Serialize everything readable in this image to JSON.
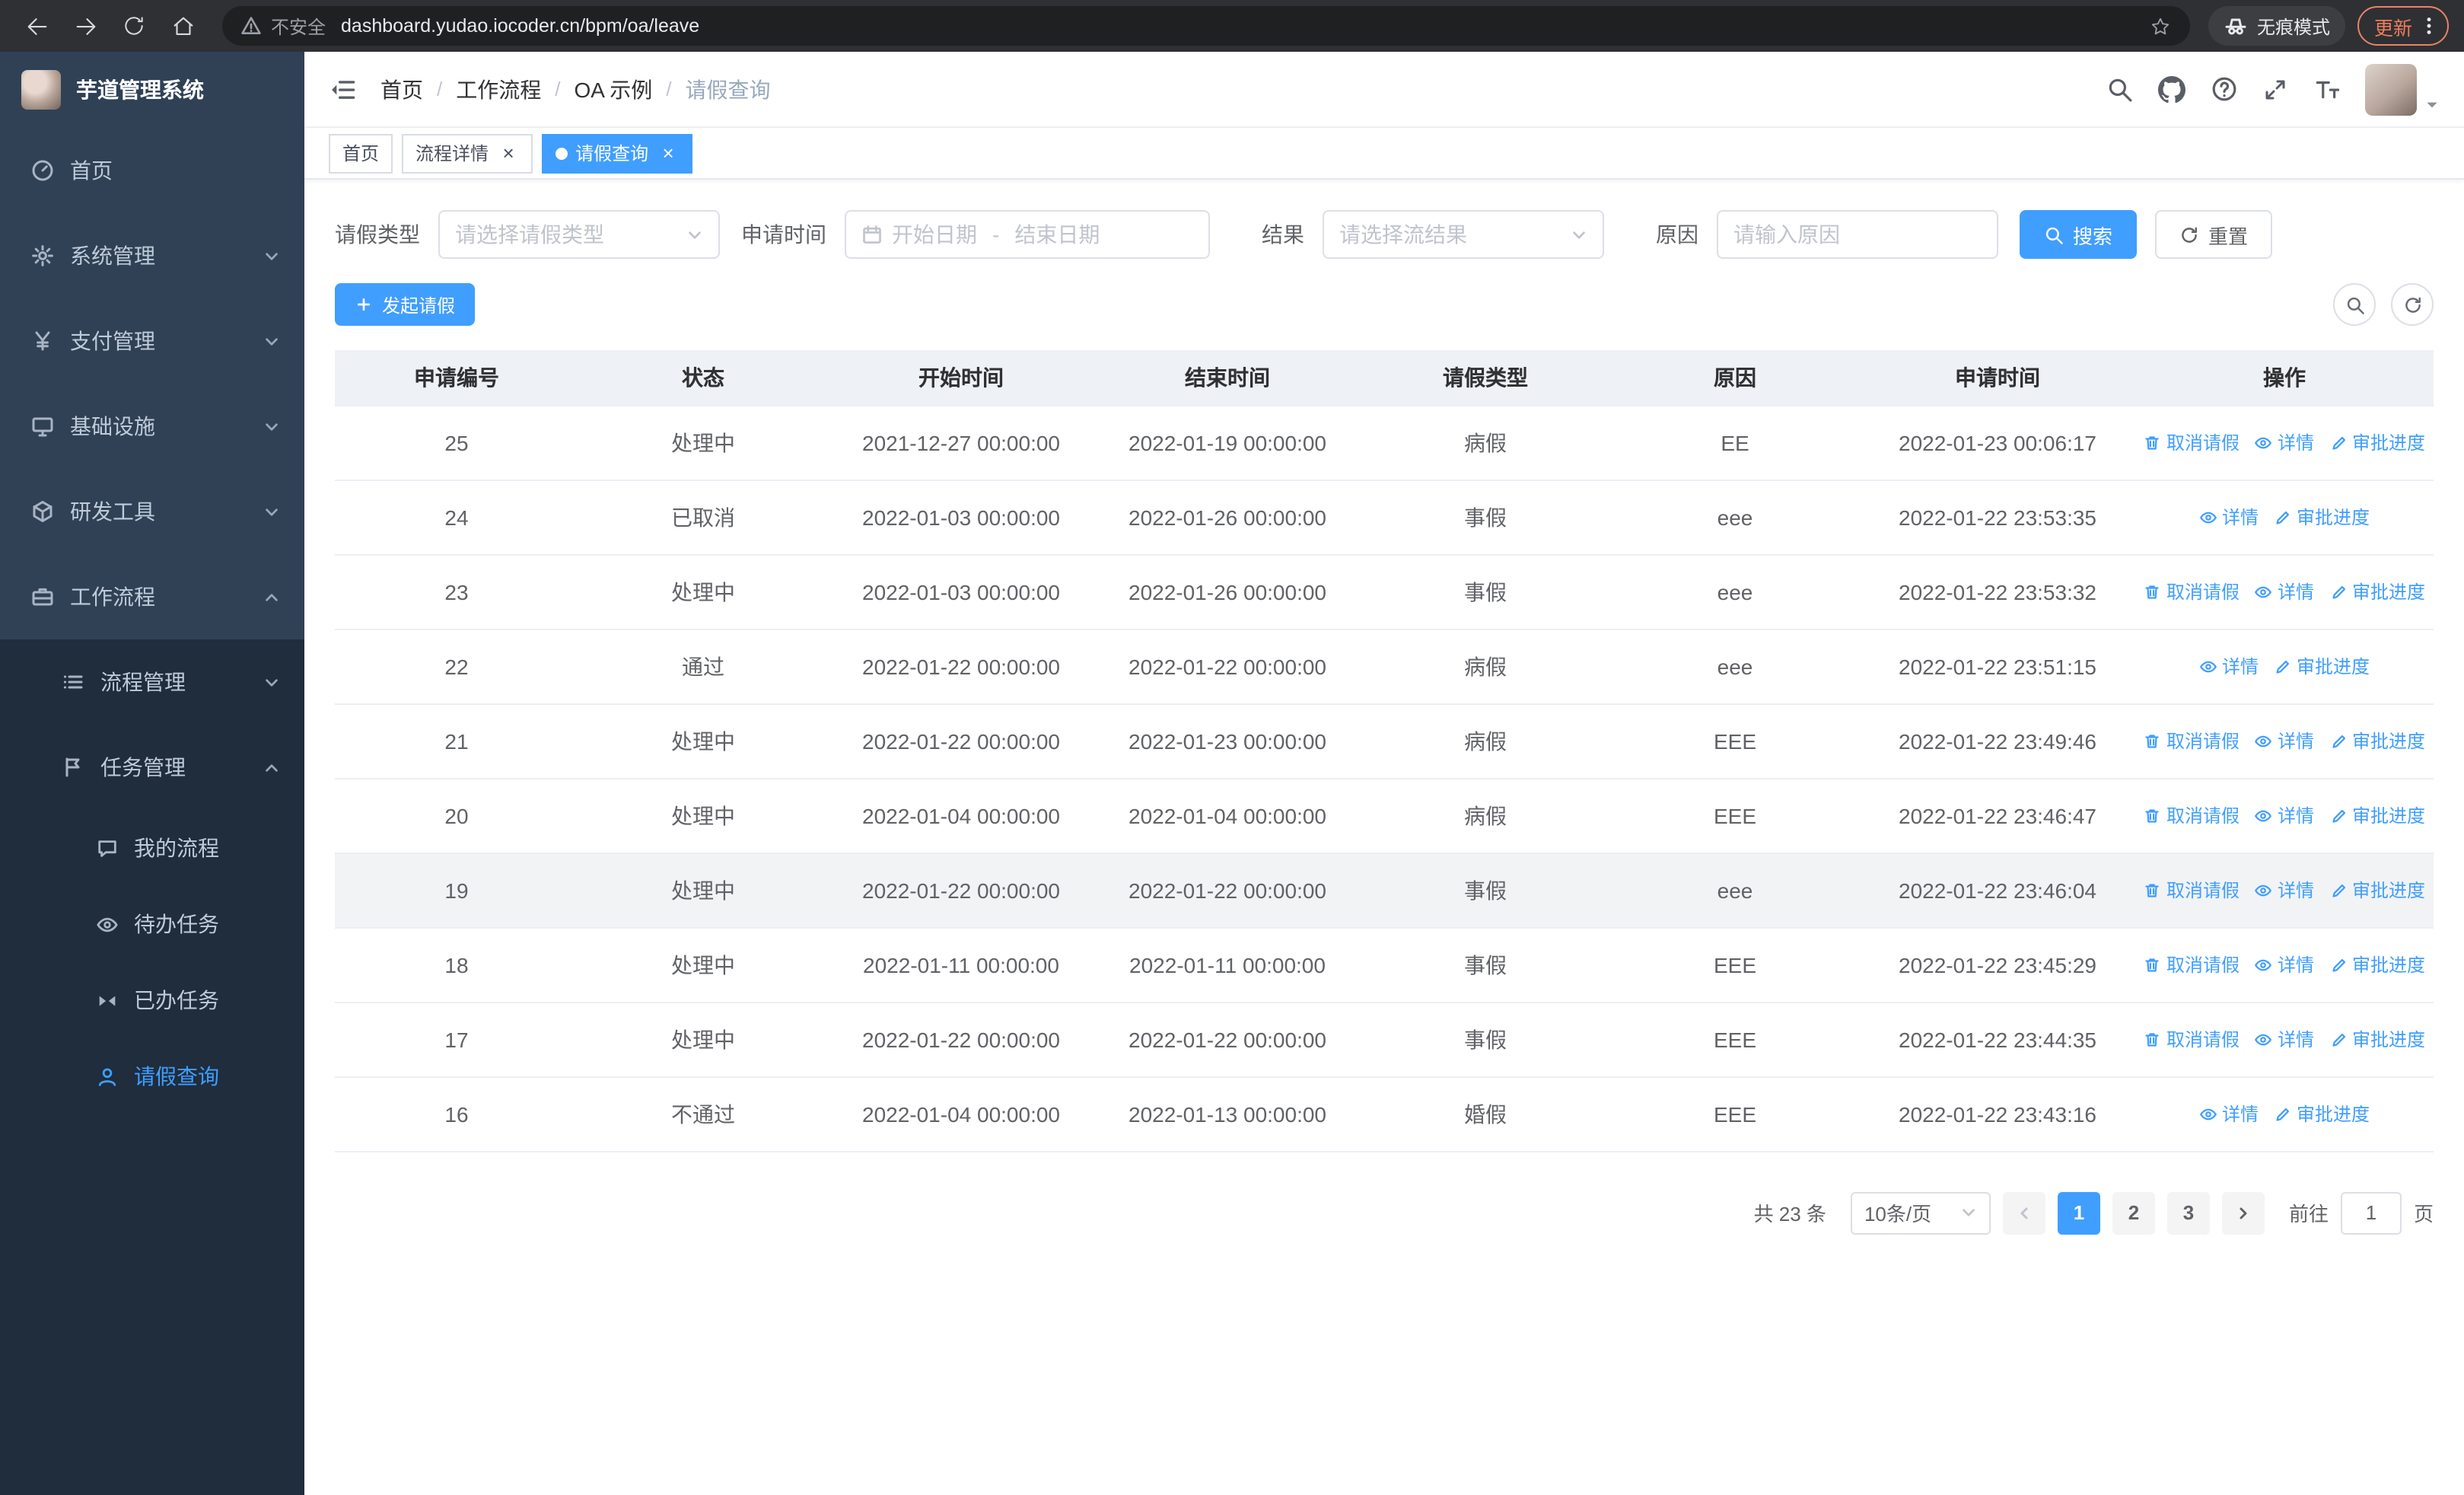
{
  "browser": {
    "security_label": "不安全",
    "url": "dashboard.yudao.iocoder.cn/bpm/oa/leave",
    "incognito_label": "无痕模式",
    "update_label": "更新"
  },
  "glyphs": {
    "close": "×"
  },
  "sidebar": {
    "logo_title": "芋道管理系统",
    "items": [
      {
        "label": "首页"
      },
      {
        "label": "系统管理"
      },
      {
        "label": "支付管理"
      },
      {
        "label": "基础设施"
      },
      {
        "label": "研发工具"
      },
      {
        "label": "工作流程"
      }
    ],
    "workflow_children": [
      {
        "label": "流程管理"
      },
      {
        "label": "任务管理"
      }
    ],
    "task_children": [
      {
        "label": "我的流程"
      },
      {
        "label": "待办任务"
      },
      {
        "label": "已办任务"
      },
      {
        "label": "请假查询"
      }
    ]
  },
  "header": {
    "breadcrumb": [
      "首页",
      "工作流程",
      "OA 示例",
      "请假查询"
    ],
    "separator": "/"
  },
  "tabs": [
    {
      "label": "首页"
    },
    {
      "label": "流程详情"
    },
    {
      "label": "请假查询"
    }
  ],
  "filters": {
    "leave_type_label": "请假类型",
    "leave_type_placeholder": "请选择请假类型",
    "apply_time_label": "申请时间",
    "start_date_placeholder": "开始日期",
    "range_separator": "-",
    "end_date_placeholder": "结束日期",
    "result_label": "结果",
    "result_placeholder": "请选择流结果",
    "reason_label": "原因",
    "reason_placeholder": "请输入原因",
    "search_label": "搜索",
    "reset_label": "重置"
  },
  "toolbar": {
    "create_label": "发起请假"
  },
  "table": {
    "columns": [
      "申请编号",
      "状态",
      "开始时间",
      "结束时间",
      "请假类型",
      "原因",
      "申请时间",
      "操作"
    ],
    "ops": {
      "cancel": "取消请假",
      "detail": "详情",
      "progress": "审批进度"
    },
    "rows": [
      {
        "id": "25",
        "status": "处理中",
        "start": "2021-12-27 00:00:00",
        "end": "2022-01-19 00:00:00",
        "type": "病假",
        "reason": "EE",
        "applied": "2022-01-23 00:06:17"
      },
      {
        "id": "24",
        "status": "已取消",
        "start": "2022-01-03 00:00:00",
        "end": "2022-01-26 00:00:00",
        "type": "事假",
        "reason": "eee",
        "applied": "2022-01-22 23:53:35"
      },
      {
        "id": "23",
        "status": "处理中",
        "start": "2022-01-03 00:00:00",
        "end": "2022-01-26 00:00:00",
        "type": "事假",
        "reason": "eee",
        "applied": "2022-01-22 23:53:32"
      },
      {
        "id": "22",
        "status": "通过",
        "start": "2022-01-22 00:00:00",
        "end": "2022-01-22 00:00:00",
        "type": "病假",
        "reason": "eee",
        "applied": "2022-01-22 23:51:15"
      },
      {
        "id": "21",
        "status": "处理中",
        "start": "2022-01-22 00:00:00",
        "end": "2022-01-23 00:00:00",
        "type": "病假",
        "reason": "EEE",
        "applied": "2022-01-22 23:49:46"
      },
      {
        "id": "20",
        "status": "处理中",
        "start": "2022-01-04 00:00:00",
        "end": "2022-01-04 00:00:00",
        "type": "病假",
        "reason": "EEE",
        "applied": "2022-01-22 23:46:47"
      },
      {
        "id": "19",
        "status": "处理中",
        "start": "2022-01-22 00:00:00",
        "end": "2022-01-22 00:00:00",
        "type": "事假",
        "reason": "eee",
        "applied": "2022-01-22 23:46:04"
      },
      {
        "id": "18",
        "status": "处理中",
        "start": "2022-01-11 00:00:00",
        "end": "2022-01-11 00:00:00",
        "type": "事假",
        "reason": "EEE",
        "applied": "2022-01-22 23:45:29"
      },
      {
        "id": "17",
        "status": "处理中",
        "start": "2022-01-22 00:00:00",
        "end": "2022-01-22 00:00:00",
        "type": "事假",
        "reason": "EEE",
        "applied": "2022-01-22 23:44:35"
      },
      {
        "id": "16",
        "status": "不通过",
        "start": "2022-01-04 00:00:00",
        "end": "2022-01-13 00:00:00",
        "type": "婚假",
        "reason": "EEE",
        "applied": "2022-01-22 23:43:16"
      }
    ]
  },
  "pagination": {
    "total_label": "共 23 条",
    "page_size": "10条/页",
    "pages": [
      "1",
      "2",
      "3"
    ],
    "active_page": "1",
    "goto_label": "前往",
    "goto_value": "1",
    "page_suffix": "页"
  },
  "colors": {
    "primary": "#409eff",
    "sidebar_bg": "#304156",
    "submenu_bg": "#1f2d3d"
  }
}
